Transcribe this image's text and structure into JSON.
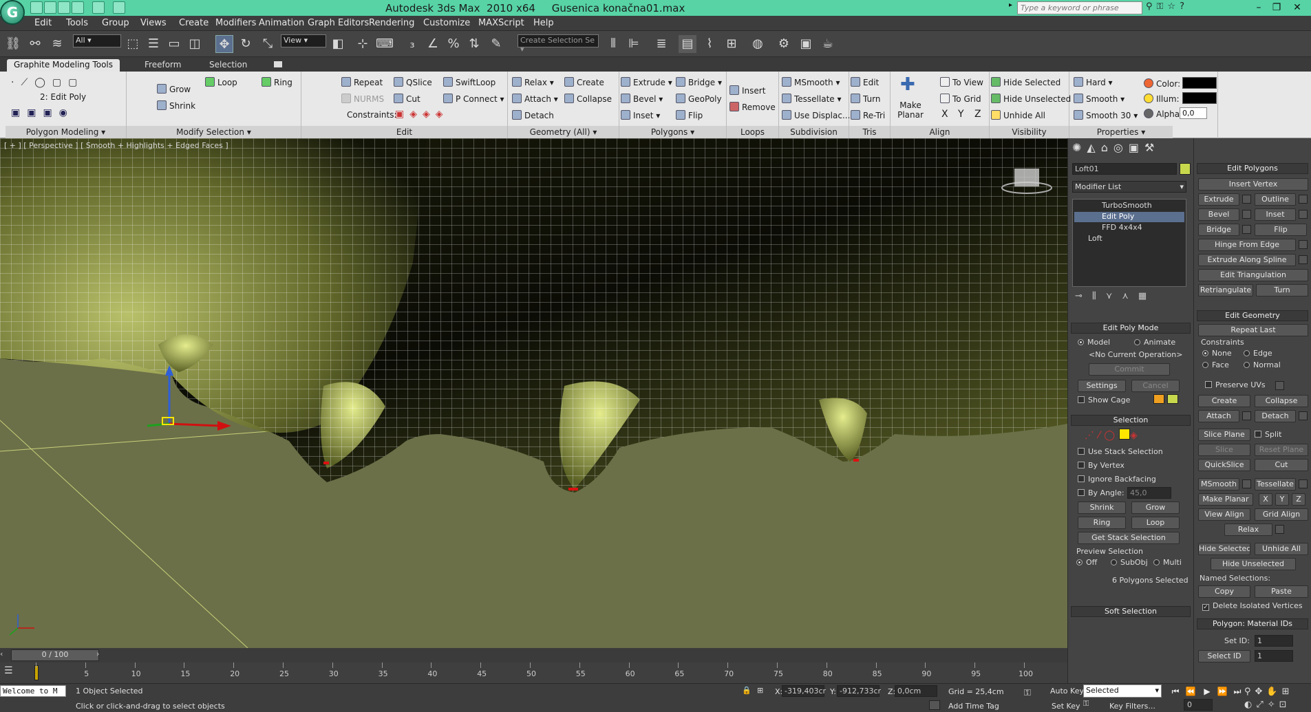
{
  "app": {
    "title": "Autodesk 3ds Max  2010 x64     Gusenica konačna01.max",
    "search_placeholder": "Type a keyword or phrase"
  },
  "menu": [
    "Edit",
    "Tools",
    "Group",
    "Views",
    "Create",
    "Modifiers",
    "Animation",
    "Graph Editors",
    "Rendering",
    "Customize",
    "MAXScript",
    "Help"
  ],
  "toolbar": {
    "filter_value": "All",
    "refcoord_value": "View",
    "selection_set_placeholder": "Create Selection Se"
  },
  "ribbon_tabs": [
    "Graphite Modeling Tools",
    "Freeform",
    "Selection"
  ],
  "ribbon": {
    "polygon_modeling": {
      "label": "Polygon Modeling",
      "mode": "2: Edit Poly"
    },
    "modify_selection": {
      "label": "Modify Selection",
      "grow": "Grow",
      "shrink": "Shrink",
      "loop": "Loop",
      "ring": "Ring"
    },
    "edit": {
      "label": "Edit",
      "repeat": "Repeat",
      "nurms": "NURMS",
      "qslice": "QSlice",
      "cut": "Cut",
      "swiftloop": "SwiftLoop",
      "pconnect": "P Connect",
      "constraints": "Constraints:"
    },
    "geometry": {
      "label": "Geometry (All)",
      "relax": "Relax",
      "attach": "Attach",
      "detach": "Detach",
      "create": "Create",
      "collapse": "Collapse"
    },
    "polygons": {
      "label": "Polygons",
      "extrude": "Extrude",
      "bevel": "Bevel",
      "inset": "Inset",
      "bridge": "Bridge",
      "geopoly": "GeoPoly",
      "flip": "Flip"
    },
    "loops": {
      "label": "Loops",
      "insert": "Insert",
      "remove": "Remove"
    },
    "subdivision": {
      "label": "Subdivision",
      "msmooth": "MSmooth",
      "tessellate": "Tessellate",
      "use_displac": "Use Displac..."
    },
    "tris": {
      "label": "Tris",
      "edit": "Edit",
      "turn": "Turn",
      "reti": "Re-Tri"
    },
    "align": {
      "label": "Align",
      "make_planar": "Make Planar",
      "to_view": "To View",
      "to_grid": "To Grid",
      "x": "X",
      "y": "Y",
      "z": "Z"
    },
    "visibility": {
      "label": "Visibility",
      "hide_selected": "Hide Selected",
      "hide_unselected": "Hide Unselected",
      "unhide_all": "Unhide All"
    },
    "shading": {
      "hard": "Hard",
      "smooth": "Smooth",
      "smooth30": "Smooth 30"
    },
    "properties": {
      "label": "Properties",
      "color": "Color:",
      "illum": "Illum:",
      "alpha": "Alpha:",
      "alpha_value": "0,0"
    }
  },
  "viewport": {
    "label": "[ + ] [ Perspective ] [ Smooth + Highlights + Edged Faces ]",
    "colors": {
      "ground": "#6b7048",
      "mesh": "#c8d36a",
      "wire": "#ffffff"
    }
  },
  "timeline": {
    "frame_label": "0 / 100",
    "ticks": [
      "0",
      "5",
      "10",
      "15",
      "20",
      "25",
      "30",
      "35",
      "40",
      "45",
      "50",
      "55",
      "60",
      "65",
      "70",
      "75",
      "80",
      "85",
      "90",
      "95",
      "100"
    ]
  },
  "command_panel": {
    "object_name": "Loft01",
    "modifier_list": "Modifier List",
    "stack": [
      "TurboSmooth",
      "Edit Poly",
      "FFD 4x4x4",
      "Loft"
    ],
    "edit_poly_mode": {
      "title": "Edit Poly Mode",
      "model": "Model",
      "animate": "Animate",
      "operation": "<No Current Operation>",
      "commit": "Commit",
      "settings": "Settings",
      "cancel": "Cancel",
      "show_cage": "Show Cage"
    },
    "selection": {
      "title": "Selection",
      "use_stack": "Use Stack Selection",
      "by_vertex": "By Vertex",
      "ignore_backfacing": "Ignore Backfacing",
      "by_angle": "By Angle:",
      "angle_value": "45,0",
      "shrink": "Shrink",
      "grow": "Grow",
      "ring": "Ring",
      "loop": "Loop",
      "get_stack": "Get Stack Selection",
      "preview": "Preview Selection",
      "off": "Off",
      "subobj": "SubObj",
      "multi": "Multi",
      "status": "6 Polygons Selected"
    },
    "soft_selection": "Soft Selection"
  },
  "edit_polygons": {
    "title": "Edit Polygons",
    "insert_vertex": "Insert Vertex",
    "extrude": "Extrude",
    "outline": "Outline",
    "bevel": "Bevel",
    "inset": "Inset",
    "bridge": "Bridge",
    "flip": "Flip",
    "hinge": "Hinge From Edge",
    "extrude_spline": "Extrude Along Spline",
    "edit_tri": "Edit Triangulation",
    "retriangulate": "Retriangulate",
    "turn": "Turn"
  },
  "edit_geometry": {
    "title": "Edit Geometry",
    "repeat_last": "Repeat Last",
    "constraints": "Constraints",
    "none": "None",
    "edge": "Edge",
    "face": "Face",
    "normal": "Normal",
    "preserve_uvs": "Preserve UVs",
    "create": "Create",
    "collapse": "Collapse",
    "attach": "Attach",
    "detach": "Detach",
    "slice_plane": "Slice Plane",
    "split": "Split",
    "slice": "Slice",
    "reset_plane": "Reset Plane",
    "quickslice": "QuickSlice",
    "cut": "Cut",
    "msmooth": "MSmooth",
    "tessellate": "Tessellate",
    "make_planar": "Make Planar",
    "x": "X",
    "y": "Y",
    "z": "Z",
    "view_align": "View Align",
    "grid_align": "Grid Align",
    "relax": "Relax",
    "hide_selected": "Hide Selected",
    "unhide_all": "Unhide All",
    "hide_unselected": "Hide Unselected",
    "named_sel": "Named Selections:",
    "copy": "Copy",
    "paste": "Paste",
    "delete_isolated": "Delete Isolated Vertices"
  },
  "material_ids": {
    "title": "Polygon: Material IDs",
    "set_id": "Set ID:",
    "select_id": "Select ID",
    "set_val": "1",
    "select_val": "1"
  },
  "status": {
    "welcome": "Welcome to M",
    "selected": "1 Object Selected",
    "prompt": "Click or click-and-drag to select objects",
    "x": "-319,403cr",
    "y": "-912,733cr",
    "z": "0,0cm",
    "grid": "Grid = 25,4cm",
    "autokey": "Auto Key",
    "setkey": "Set Key",
    "selected_combo": "Selected",
    "key_filters": "Key Filters...",
    "add_time_tag": "Add Time Tag",
    "frame": "0"
  }
}
